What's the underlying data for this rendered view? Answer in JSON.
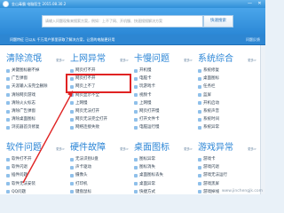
{
  "window": {
    "title": "金山毒霸 电脑医生 2015.08.30.2",
    "minimize_glyph": "—",
    "close_glyph": "✕"
  },
  "search": {
    "placeholder": "请输入问题现象来搜索方案，例如：上不了网、开机慢、快速搜搜解决方案",
    "button_label": "快速搜索"
  },
  "info_strip": {
    "text": "问题特征  已以从 千万用户那里获取了解决方案，让您的电脑更好用",
    "link": "问题反馈"
  },
  "categories": [
    {
      "title": "清除流氓",
      "more": "更多>",
      "items": [
        "关键图标删不掉",
        "广告弹窗",
        "天涯输入法完全删除",
        "清除网页游戏",
        "清除火火标志",
        "清除广告弹窗",
        "清除桌面图标",
        "浏览器首页修复"
      ]
    },
    {
      "title": "上网异常",
      "more": "更多>",
      "items": [
        "网页打不开",
        "网页打不开",
        "网页上不了",
        "网页显示不全",
        "上网慢",
        "网页无法打开",
        "网页无法完全打开",
        "网络连接失败"
      ]
    },
    {
      "title": "卡慢问题",
      "more": "更多>",
      "items": [
        "开机慢",
        "电脑卡",
        "玩游戏卡",
        "视频卡",
        "上网慢",
        "网页打开慢",
        "打开文件卡",
        "电脑运行慢"
      ]
    },
    {
      "title": "系统综合",
      "more": "更多>",
      "items": [
        "系统修复",
        "桌面图标",
        "任务栏",
        "蓝屏",
        "开机启动",
        "系统声音",
        "系统时间",
        "系统异常"
      ]
    },
    {
      "title": "软件问题",
      "more": "更多>",
      "items": [
        "软件打不开",
        "软件闪退",
        "插件问题",
        "软件无法安装",
        "QQ问题"
      ]
    },
    {
      "title": "硬件故障",
      "more": "更多>",
      "items": [
        "无法识别U盘",
        "声卡驱动",
        "摄像头",
        "打印机",
        "键盘鼠标"
      ]
    },
    {
      "title": "桌面图标",
      "more": "更多>",
      "items": [
        "图标异常",
        "图标消失",
        "桌面图标丢失",
        "桌面异常",
        "快捷方式"
      ]
    },
    {
      "title": "游戏异常",
      "more": "更多>",
      "items": [
        "游戏卡",
        "游戏闪退",
        "游戏无法运行",
        "游戏黑屏",
        "游戏掉线"
      ]
    }
  ],
  "watermark": "www.jinchengjk.com",
  "colors": {
    "title_blue": "#2c86d6",
    "highlight_red": "#e02323"
  }
}
